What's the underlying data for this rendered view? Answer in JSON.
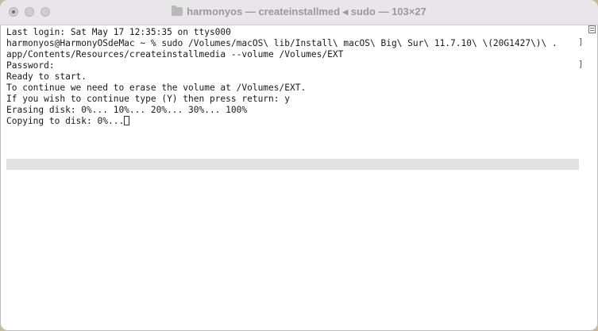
{
  "window": {
    "title": "harmonyos — createinstallmed ◂ sudo — 103×27"
  },
  "terminal": {
    "lines": [
      "Last login: Sat May 17 12:35:35 on ttys000",
      "harmonyos@HarmonyOSdeMac ~ % sudo /Volumes/macOS\\ lib/Install\\ macOS\\ Big\\ Sur\\ 11.7.10\\ \\(20G1427\\)\\ .",
      "app/Contents/Resources/createinstallmedia --volume /Volumes/EXT",
      "Password:",
      "Ready to start.",
      "To continue we need to erase the volume at /Volumes/EXT.",
      "If you wish to continue type (Y) then press return: y",
      "Erasing disk: 0%... 10%... 20%... 30%... 100%",
      "Copying to disk: 0%..."
    ]
  }
}
